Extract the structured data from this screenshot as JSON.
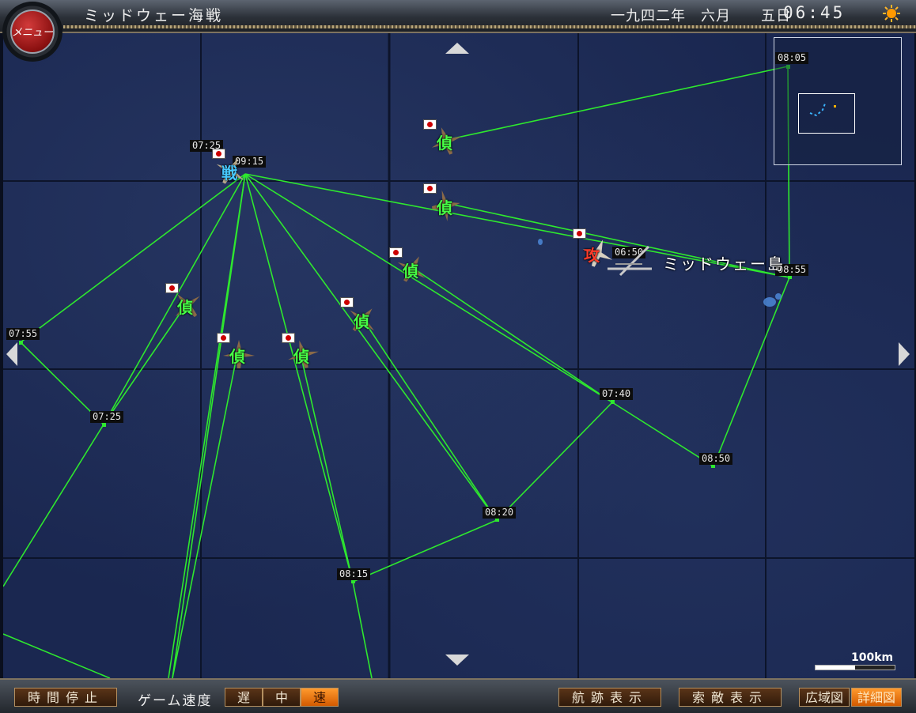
{
  "header": {
    "title": "ミッドウェー海戦",
    "date": "一九四二年　六月　　五日",
    "time": "06:45",
    "menu_label": "メニュー",
    "weather_icon": "sun-icon"
  },
  "map": {
    "place_label": "ミッドウェー島",
    "waypoints": [
      {
        "id": "wp0805",
        "label": "08:05"
      },
      {
        "id": "wp0755",
        "label": "07:55"
      },
      {
        "id": "wp0725b",
        "label": "07:25"
      },
      {
        "id": "wp0740",
        "label": "07:40"
      },
      {
        "id": "wp0850",
        "label": "08:50"
      },
      {
        "id": "wp0855",
        "label": "08:55"
      },
      {
        "id": "wp0820",
        "label": "08:20"
      },
      {
        "id": "wp0815",
        "label": "08:15"
      }
    ],
    "fighter_labels": {
      "a": "07:25",
      "b": "09:15"
    },
    "enemy_label": "06:50",
    "scout_kanji": "偵",
    "fighter_kanji": "戦",
    "enemy_kanji": "攻",
    "scale_label": "100km",
    "colors": {
      "route": "#2ee82e",
      "ocean": "#1a2750",
      "accent": "#ff8c1a"
    }
  },
  "toolbar": {
    "pause": "時間停止",
    "speed_label": "ゲーム速度",
    "speed_slow": "遅",
    "speed_mid": "中",
    "speed_fast": "速",
    "speed_selected": "速",
    "track": "航跡表示",
    "search": "索敵表示",
    "wide_map": "広域図",
    "detail_map": "詳細図",
    "map_selected": "詳細図"
  }
}
